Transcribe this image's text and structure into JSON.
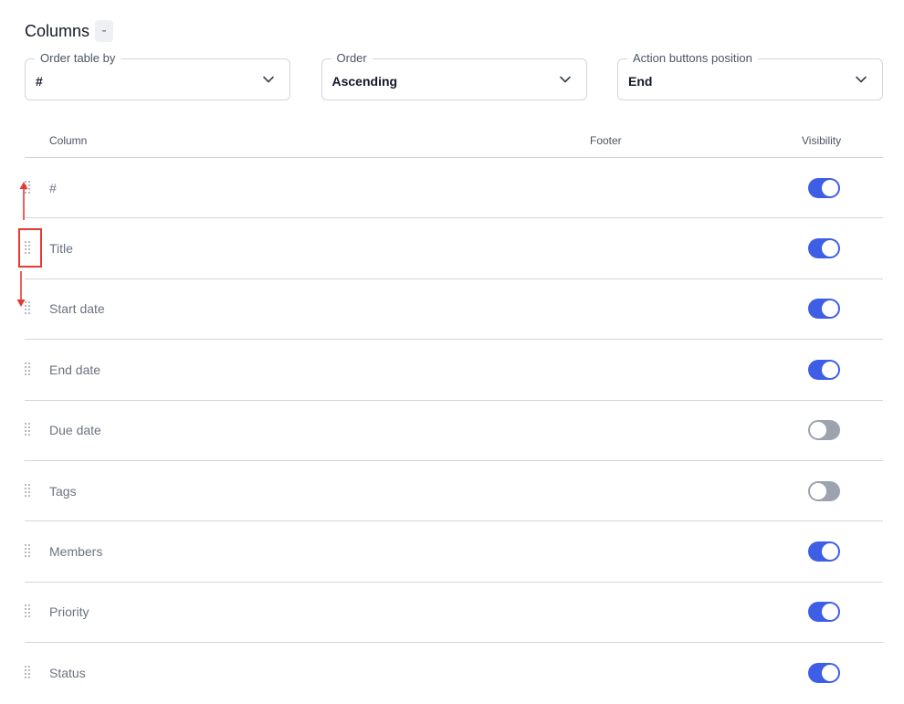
{
  "header": {
    "title": "Columns",
    "collapse_label": "-"
  },
  "selects": [
    {
      "label": "Order table by",
      "value": "#",
      "icon": "chevron-down-icon"
    },
    {
      "label": "Order",
      "value": "Ascending",
      "icon": "chevron-down-icon"
    },
    {
      "label": "Action buttons position",
      "value": "End",
      "icon": "chevron-down-icon"
    }
  ],
  "table": {
    "headers": {
      "column": "Column",
      "footer": "Footer",
      "visibility": "Visibility"
    },
    "rows": [
      {
        "label": "#",
        "visible": true
      },
      {
        "label": "Title",
        "visible": true
      },
      {
        "label": "Start date",
        "visible": true
      },
      {
        "label": "End date",
        "visible": true
      },
      {
        "label": "Due date",
        "visible": false
      },
      {
        "label": "Tags",
        "visible": false
      },
      {
        "label": "Members",
        "visible": true
      },
      {
        "label": "Priority",
        "visible": true
      },
      {
        "label": "Status",
        "visible": true
      }
    ]
  },
  "colors": {
    "toggle_on": "#3f5ee6",
    "toggle_off": "#9ca3af",
    "annotation": "#e53935"
  },
  "icons": {
    "drag_handle": "drag-handle-icon",
    "annotation_up": "arrow-up-icon",
    "annotation_down": "arrow-down-icon"
  }
}
